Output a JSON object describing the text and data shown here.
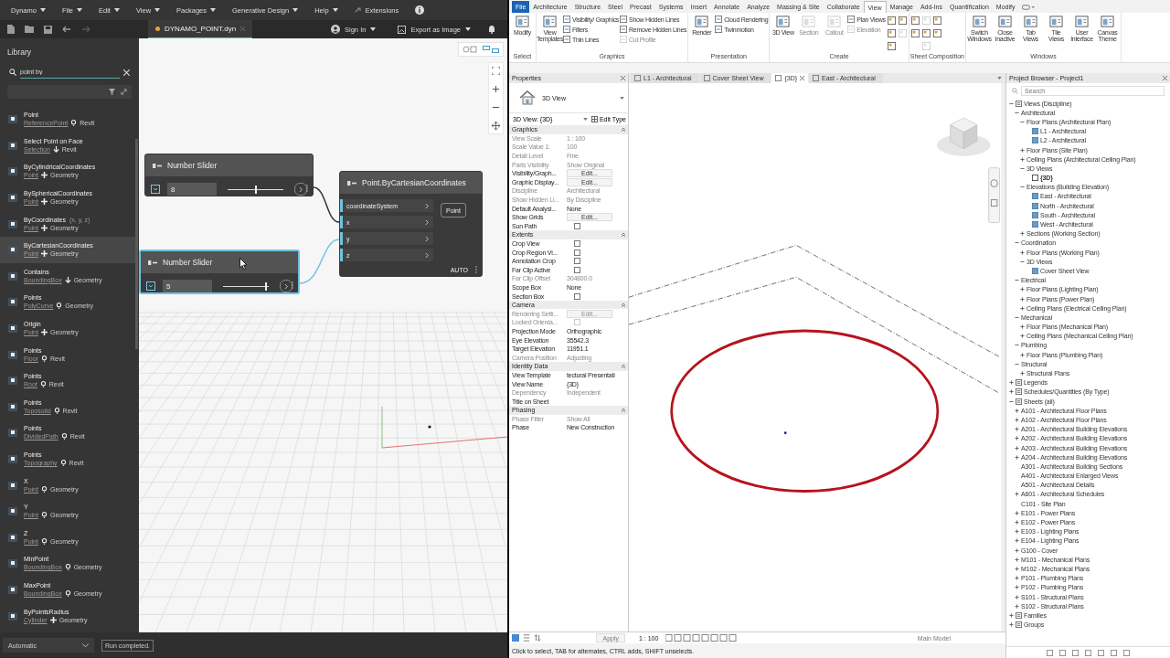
{
  "dynamo": {
    "menu": [
      {
        "label": "Dynamo",
        "dropdown": true
      },
      {
        "label": "File",
        "dropdown": true
      },
      {
        "label": "Edit",
        "dropdown": true
      },
      {
        "label": "View",
        "dropdown": true
      },
      {
        "label": "Packages",
        "dropdown": true
      },
      {
        "label": "Generative Design",
        "dropdown": true
      },
      {
        "label": "Help",
        "dropdown": true
      },
      {
        "label": "Extensions",
        "dropdown": false
      }
    ],
    "file_tab": {
      "label": "DYNAMO_POINT.dyn",
      "unsaved": true
    },
    "sign_in": "Sign In",
    "export": "Export as Image",
    "library": {
      "title": "Library",
      "search": "point by",
      "items": [
        {
          "name": "Point",
          "category": "ReferencePoint",
          "kind": "query",
          "library": "Revit",
          "selected": false
        },
        {
          "name": "Select Point on Face",
          "category": "Selection",
          "kind": "action",
          "library": "Revit",
          "selected": false
        },
        {
          "name": "ByCylindricalCoordinates",
          "category": "Point",
          "kind": "create",
          "library": "Geometry",
          "selected": false
        },
        {
          "name": "BySphericalCoordinates",
          "category": "Point",
          "kind": "create",
          "library": "Geometry",
          "selected": false
        },
        {
          "name": "ByCoordinates",
          "hint": "(x, y, z)",
          "category": "Point",
          "kind": "create",
          "library": "Geometry",
          "selected": false
        },
        {
          "name": "ByCartesianCoordinates",
          "category": "Point",
          "kind": "create",
          "library": "Geometry",
          "selected": true
        },
        {
          "name": "Contains",
          "category": "BoundingBox",
          "kind": "action",
          "library": "Geometry",
          "selected": false
        },
        {
          "name": "Points",
          "category": "PolyCurve",
          "kind": "query",
          "library": "Geometry",
          "selected": false
        },
        {
          "name": "Origin",
          "category": "Point",
          "kind": "create",
          "library": "Geometry",
          "selected": false
        },
        {
          "name": "Points",
          "category": "Floor",
          "kind": "query",
          "library": "Revit",
          "selected": false
        },
        {
          "name": "Points",
          "category": "Roof",
          "kind": "query",
          "library": "Revit",
          "selected": false
        },
        {
          "name": "Points",
          "category": "Toposolid",
          "kind": "query",
          "library": "Revit",
          "selected": false
        },
        {
          "name": "Points",
          "category": "DividedPath",
          "kind": "query",
          "library": "Revit",
          "selected": false
        },
        {
          "name": "Points",
          "category": "Topography",
          "kind": "query",
          "library": "Revit",
          "selected": false
        },
        {
          "name": "X",
          "category": "Point",
          "kind": "query",
          "library": "Geometry",
          "selected": false
        },
        {
          "name": "Y",
          "category": "Point",
          "kind": "query",
          "library": "Geometry",
          "selected": false
        },
        {
          "name": "Z",
          "category": "Point",
          "kind": "query",
          "library": "Geometry",
          "selected": false
        },
        {
          "name": "MinPoint",
          "category": "BoundingBox",
          "kind": "query",
          "library": "Geometry",
          "selected": false
        },
        {
          "name": "MaxPoint",
          "category": "BoundingBox",
          "kind": "query",
          "library": "Geometry",
          "selected": false
        },
        {
          "name": "ByPointsRadius",
          "category": "Cylinder",
          "kind": "create",
          "library": "Geometry",
          "selected": false
        }
      ]
    },
    "nodes": [
      {
        "kind": "slider",
        "title": "Number Slider",
        "value": "8",
        "level": 0.5,
        "selected": false
      },
      {
        "kind": "slider",
        "title": "Number Slider",
        "value": "5",
        "level": 0.93,
        "selected": true
      },
      {
        "kind": "function",
        "title": "Point.ByCartesianCoordinates",
        "inputs": [
          "coordinateSystem",
          "x",
          "y",
          "z"
        ],
        "output": "Point",
        "run_mode": "AUTO",
        "selected": false
      }
    ],
    "run": {
      "mode": "Automatic",
      "status": "Run completed."
    }
  },
  "revit": {
    "tabs": [
      {
        "label": "File",
        "selected": false
      },
      {
        "label": "Architecture",
        "selected": false
      },
      {
        "label": "Structure",
        "selected": false
      },
      {
        "label": "Steel",
        "selected": false
      },
      {
        "label": "Precast",
        "selected": false
      },
      {
        "label": "Systems",
        "selected": false
      },
      {
        "label": "Insert",
        "selected": false
      },
      {
        "label": "Annotate",
        "selected": false
      },
      {
        "label": "Analyze",
        "selected": false
      },
      {
        "label": "Massing & Site",
        "selected": false
      },
      {
        "label": "Collaborate",
        "selected": false
      },
      {
        "label": "View",
        "selected": true
      },
      {
        "label": "Manage",
        "selected": false
      },
      {
        "label": "Add-Ins",
        "selected": false
      },
      {
        "label": "Quantification",
        "selected": false
      },
      {
        "label": "Modify",
        "selected": false
      }
    ],
    "groups": [
      {
        "label": "Select",
        "columns": [
          [
            {
              "kind": "large",
              "label": "Modify",
              "disabled": false
            }
          ]
        ]
      },
      {
        "label": "Graphics",
        "columns": [
          [
            {
              "kind": "large",
              "label": "View Templates",
              "disabled": false
            }
          ],
          [
            {
              "kind": "small",
              "label": "Visibility/ Graphics",
              "disabled": false
            },
            {
              "kind": "small",
              "label": "Filters",
              "disabled": false
            },
            {
              "kind": "small",
              "label": "Thin Lines",
              "disabled": false
            }
          ],
          [
            {
              "kind": "small",
              "label": "Show Hidden Lines",
              "disabled": false
            },
            {
              "kind": "small",
              "label": "Remove Hidden Lines",
              "disabled": false
            },
            {
              "kind": "small",
              "label": "Cut Profile",
              "disabled": true
            }
          ]
        ]
      },
      {
        "label": "Presentation",
        "columns": [
          [
            {
              "kind": "large",
              "label": "Render",
              "disabled": false
            }
          ],
          [
            {
              "kind": "small",
              "label": "Cloud Rendering",
              "disabled": false
            },
            {
              "kind": "small",
              "label": "Twinmotion",
              "disabled": false
            }
          ]
        ]
      },
      {
        "label": "Create",
        "columns": [
          [
            {
              "kind": "large",
              "label": "3D View",
              "disabled": false
            }
          ],
          [
            {
              "kind": "large",
              "label": "Section",
              "disabled": true
            }
          ],
          [
            {
              "kind": "large",
              "label": "Callout",
              "disabled": true
            }
          ],
          [
            {
              "kind": "small",
              "label": "Plan Views",
              "disabled": false
            },
            {
              "kind": "small",
              "label": "Elevation",
              "disabled": true
            }
          ],
          [
            {
              "kind": "icon",
              "disabled": false
            },
            {
              "kind": "icon",
              "disabled": false
            },
            {
              "kind": "icon",
              "disabled": false
            }
          ],
          [
            {
              "kind": "icon",
              "disabled": false
            },
            {
              "kind": "icon",
              "disabled": true
            }
          ]
        ]
      },
      {
        "label": "Sheet Composition",
        "columns": [
          [
            {
              "kind": "icon",
              "disabled": false
            },
            {
              "kind": "icon",
              "disabled": false
            }
          ],
          [
            {
              "kind": "icon",
              "disabled": true
            },
            {
              "kind": "icon",
              "disabled": false
            },
            {
              "kind": "icon",
              "disabled": true
            }
          ],
          [
            {
              "kind": "icon",
              "disabled": false
            },
            {
              "kind": "icon",
              "disabled": false
            }
          ]
        ]
      },
      {
        "label": "Windows",
        "columns": [
          [
            {
              "kind": "large",
              "label": "Switch Windows",
              "disabled": false
            }
          ],
          [
            {
              "kind": "large",
              "label": "Close Inactive",
              "disabled": false
            }
          ],
          [
            {
              "kind": "large",
              "label": "Tab Views",
              "disabled": false
            }
          ],
          [
            {
              "kind": "large",
              "label": "Tile Views",
              "disabled": false
            }
          ],
          [
            {
              "kind": "large",
              "label": "User Interface",
              "disabled": false
            }
          ],
          [
            {
              "kind": "large",
              "label": "Canvas Theme",
              "disabled": false
            }
          ]
        ]
      }
    ],
    "view_tabs": [
      {
        "label": "L1 - Architectural",
        "selected": false
      },
      {
        "label": "Cover Sheet View",
        "selected": false
      },
      {
        "label": "{3D}",
        "selected": true
      },
      {
        "label": "East - Architectural",
        "selected": false
      }
    ],
    "properties": {
      "title": "Properties",
      "type": "3D View",
      "instance": "3D View: {3D}",
      "edit_type": "Edit Type",
      "apply": "Apply",
      "sections": [
        {
          "title": "Graphics",
          "rows": [
            {
              "kind": "text",
              "label": "View Scale",
              "value": "1 : 100",
              "disabled": true
            },
            {
              "kind": "text",
              "label": "Scale Value 1:",
              "value": "100",
              "disabled": true
            },
            {
              "kind": "text",
              "label": "Detail Level",
              "value": "Fine",
              "disabled": true
            },
            {
              "kind": "text",
              "label": "Parts Visibility",
              "value": "Show Original",
              "disabled": true
            },
            {
              "kind": "button",
              "label": "Visibility/Graph...",
              "value": "Edit...",
              "disabled": false
            },
            {
              "kind": "button",
              "label": "Graphic Display...",
              "value": "Edit...",
              "disabled": false
            },
            {
              "kind": "text",
              "label": "Discipline",
              "value": "Architectural",
              "disabled": true
            },
            {
              "kind": "text",
              "label": "Show Hidden Li...",
              "value": "By Discipline",
              "disabled": true
            },
            {
              "kind": "text",
              "label": "Default Analysi...",
              "value": "None",
              "disabled": false
            },
            {
              "kind": "button",
              "label": "Show Grids",
              "value": "Edit...",
              "disabled": false
            },
            {
              "kind": "checkbox",
              "label": "Sun Path",
              "checked": false,
              "disabled": false
            }
          ]
        },
        {
          "title": "Extents",
          "rows": [
            {
              "kind": "checkbox",
              "label": "Crop View",
              "checked": false,
              "disabled": false
            },
            {
              "kind": "checkbox",
              "label": "Crop Region Vi...",
              "checked": false,
              "disabled": false
            },
            {
              "kind": "checkbox",
              "label": "Annotation Crop",
              "checked": false,
              "disabled": false
            },
            {
              "kind": "checkbox",
              "label": "Far Clip Active",
              "checked": false,
              "disabled": false
            },
            {
              "kind": "text",
              "label": "Far Clip Offset",
              "value": "304800.0",
              "disabled": true
            },
            {
              "kind": "text",
              "label": "Scope Box",
              "value": "None",
              "disabled": false
            },
            {
              "kind": "checkbox",
              "label": "Section Box",
              "checked": false,
              "disabled": false
            }
          ]
        },
        {
          "title": "Camera",
          "rows": [
            {
              "kind": "button",
              "label": "Rendering Setti...",
              "value": "Edit...",
              "disabled": true
            },
            {
              "kind": "checkbox",
              "label": "Locked Orienta...",
              "checked": false,
              "disabled": true
            },
            {
              "kind": "text",
              "label": "Projection Mode",
              "value": "Orthographic",
              "disabled": false
            },
            {
              "kind": "text",
              "label": "Eye Elevation",
              "value": "35542.3",
              "disabled": false
            },
            {
              "kind": "text",
              "label": "Target Elevation",
              "value": "11951.1",
              "disabled": false
            },
            {
              "kind": "text",
              "label": "Camera Position",
              "value": "Adjusting",
              "disabled": true
            }
          ]
        },
        {
          "title": "Identity Data",
          "rows": [
            {
              "kind": "text",
              "label": "View Template",
              "value": "tectural Presentati",
              "disabled": false
            },
            {
              "kind": "text",
              "label": "View Name",
              "value": "{3D}",
              "disabled": false
            },
            {
              "kind": "text",
              "label": "Dependency",
              "value": "Independent",
              "disabled": true
            },
            {
              "kind": "text",
              "label": "Title on Sheet",
              "disabled": false
            }
          ]
        },
        {
          "title": "Phasing",
          "rows": [
            {
              "kind": "text",
              "label": "Phase Filter",
              "value": "Show All",
              "disabled": true
            },
            {
              "kind": "text",
              "label": "Phase",
              "value": "New Construction",
              "disabled": false
            }
          ]
        }
      ]
    },
    "view": {
      "scale": "1 : 100",
      "model": "Main Model"
    },
    "status": "Click to select, TAB for alternates, CTRL adds, SHIFT unselects.",
    "browser": {
      "title": "Project Browser - Project1",
      "placeholder": "Search",
      "tree": [
        {
          "label": "Views (Discipline)",
          "kind": "root",
          "expanded": true,
          "selected": false,
          "children": [
            {
              "label": "Architectural",
              "expanded": true,
              "selected": false,
              "children": [
                {
                  "label": "Floor Plans (Architectural Plan)",
                  "expanded": true,
                  "selected": false,
                  "children": [
                    {
                      "label": "L1 - Architectural",
                      "kind": "view",
                      "selected": false
                    },
                    {
                      "label": "L2 - Architectural",
                      "kind": "view",
                      "selected": false
                    }
                  ]
                },
                {
                  "label": "Floor Plans (Site Plan)",
                  "expanded": false,
                  "selected": false
                },
                {
                  "label": "Ceiling Plans (Architectural Ceiling Plan)",
                  "expanded": false,
                  "selected": false
                },
                {
                  "label": "3D Views",
                  "expanded": true,
                  "selected": false,
                  "children": [
                    {
                      "label": "{3D}",
                      "kind": "view",
                      "selected": true
                    }
                  ]
                },
                {
                  "label": "Elevations (Building Elevation)",
                  "expanded": true,
                  "selected": false,
                  "children": [
                    {
                      "label": "East - Architectural",
                      "kind": "view",
                      "selected": false
                    },
                    {
                      "label": "North - Architectural",
                      "kind": "view",
                      "selected": false
                    },
                    {
                      "label": "South - Architectural",
                      "kind": "view",
                      "selected": false
                    },
                    {
                      "label": "West - Architectural",
                      "kind": "view",
                      "selected": false
                    }
                  ]
                },
                {
                  "label": "Sections (Working Section)",
                  "expanded": false,
                  "selected": false
                }
              ]
            },
            {
              "label": "Coordination",
              "expanded": true,
              "selected": false,
              "children": [
                {
                  "label": "Floor Plans (Working Plan)",
                  "expanded": false,
                  "selected": false
                },
                {
                  "label": "3D Views",
                  "expanded": true,
                  "selected": false,
                  "children": [
                    {
                      "label": "Cover Sheet View",
                      "kind": "view",
                      "selected": false
                    }
                  ]
                }
              ]
            },
            {
              "label": "Electrical",
              "expanded": true,
              "selected": false,
              "children": [
                {
                  "label": "Floor Plans (Lighting Plan)",
                  "expanded": false,
                  "selected": false
                },
                {
                  "label": "Floor Plans (Power Plan)",
                  "expanded": false,
                  "selected": false
                },
                {
                  "label": "Ceiling Plans (Electrical Ceiling Plan)",
                  "expanded": false,
                  "selected": false
                }
              ]
            },
            {
              "label": "Mechanical",
              "expanded": true,
              "selected": false,
              "children": [
                {
                  "label": "Floor Plans (Mechanical Plan)",
                  "expanded": false,
                  "selected": false
                },
                {
                  "label": "Ceiling Plans (Mechanical Ceiling Plan)",
                  "expanded": false,
                  "selected": false
                }
              ]
            },
            {
              "label": "Plumbing",
              "expanded": true,
              "selected": false,
              "children": [
                {
                  "label": "Floor Plans (Plumbing Plan)",
                  "expanded": false,
                  "selected": false
                }
              ]
            },
            {
              "label": "Structural",
              "expanded": true,
              "selected": false,
              "children": [
                {
                  "label": "Structural Plans",
                  "expanded": false,
                  "selected": false
                }
              ]
            }
          ]
        },
        {
          "label": "Legends",
          "kind": "root",
          "expanded": false,
          "selected": false
        },
        {
          "label": "Schedules/Quantities (By Type)",
          "kind": "root",
          "expanded": false,
          "selected": false
        },
        {
          "label": "Sheets (all)",
          "kind": "root",
          "expanded": true,
          "selected": false,
          "children": [
            {
              "label": "A101 - Architectural Floor Plans",
              "expanded": false,
              "selected": false
            },
            {
              "label": "A102 - Architectural Floor Plans",
              "expanded": false,
              "selected": false
            },
            {
              "label": "A201 - Architectural Building Elevations",
              "expanded": false,
              "selected": false
            },
            {
              "label": "A202 - Architectural Building Elevations",
              "expanded": false,
              "selected": false
            },
            {
              "label": "A203 - Architectural Building Elevations",
              "expanded": false,
              "selected": false
            },
            {
              "label": "A204 - Architectural Building Elevations",
              "expanded": false,
              "selected": false
            },
            {
              "label": "A301 - Architectural Building Sections",
              "selected": false
            },
            {
              "label": "A401 - Architectural Enlarged Views",
              "selected": false
            },
            {
              "label": "A501 - Architectural Details",
              "selected": false
            },
            {
              "label": "A601 - Architectural Schedules",
              "expanded": false,
              "selected": false
            },
            {
              "label": "C101 - Site Plan",
              "selected": false
            },
            {
              "label": "E101 - Power Plans",
              "expanded": false,
              "selected": false
            },
            {
              "label": "E102 - Power Plans",
              "expanded": false,
              "selected": false
            },
            {
              "label": "E103 - Lighting Plans",
              "expanded": false,
              "selected": false
            },
            {
              "label": "E104 - Lighting Plans",
              "expanded": false,
              "selected": false
            },
            {
              "label": "G100 - Cover",
              "expanded": false,
              "selected": false
            },
            {
              "label": "M101 - Mechanical Plans",
              "expanded": false,
              "selected": false
            },
            {
              "label": "M102 - Mechanical Plans",
              "expanded": false,
              "selected": false
            },
            {
              "label": "P101 - Plumbing Plans",
              "expanded": false,
              "selected": false
            },
            {
              "label": "P102 - Plumbing Plans",
              "expanded": false,
              "selected": false
            },
            {
              "label": "S101 - Structural Plans",
              "expanded": false,
              "selected": false
            },
            {
              "label": "S102 - Structural Plans",
              "expanded": false,
              "selected": false
            }
          ]
        },
        {
          "label": "Families",
          "kind": "root",
          "expanded": false,
          "selected": false
        },
        {
          "label": "Groups",
          "kind": "root",
          "expanded": false,
          "selected": false
        }
      ]
    }
  }
}
